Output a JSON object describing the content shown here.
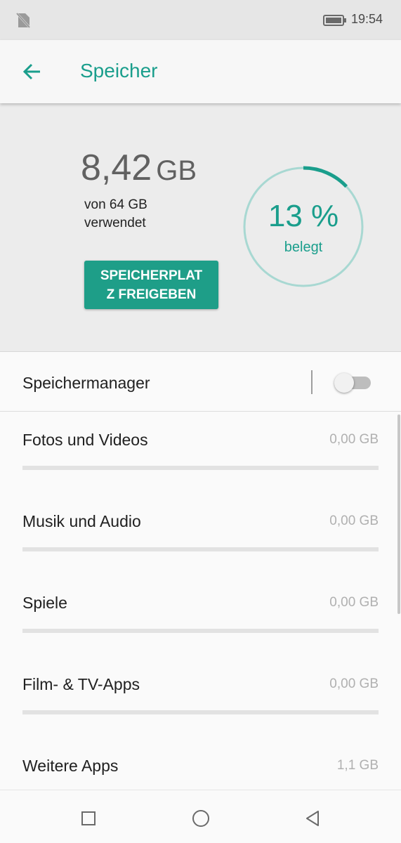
{
  "status_bar": {
    "time": "19:54",
    "icons": [
      "no-sim-icon",
      "battery-icon"
    ]
  },
  "app_bar": {
    "title": "Speicher",
    "back_icon": "arrow-back-icon",
    "accent": "#1a9e8c"
  },
  "summary": {
    "used_value": "8,42",
    "used_unit": "GB",
    "used_desc_line1": "von 64 GB",
    "used_desc_line2": "verwendet",
    "free_button_line1": "SPEICHERPLAT",
    "free_button_line2": "Z FREIGEBEN",
    "percent_text": "13 %",
    "percent_value": 13,
    "percent_label": "belegt",
    "ring_color": "#1a9e8c",
    "ring_track_color": "#a8d8d2"
  },
  "storage_manager": {
    "label": "Speichermanager",
    "enabled": false
  },
  "categories": [
    {
      "label": "Fotos und Videos",
      "size": "0,00 GB",
      "fraction": 0
    },
    {
      "label": "Musik und Audio",
      "size": "0,00 GB",
      "fraction": 0
    },
    {
      "label": "Spiele",
      "size": "0,00 GB",
      "fraction": 0
    },
    {
      "label": "Film- & TV-Apps",
      "size": "0,00 GB",
      "fraction": 0
    },
    {
      "label": "Weitere Apps",
      "size": "1,1 GB",
      "fraction": 0
    }
  ],
  "nav_bar": {
    "icons": [
      "recents-square-icon",
      "home-circle-icon",
      "back-triangle-icon"
    ]
  }
}
